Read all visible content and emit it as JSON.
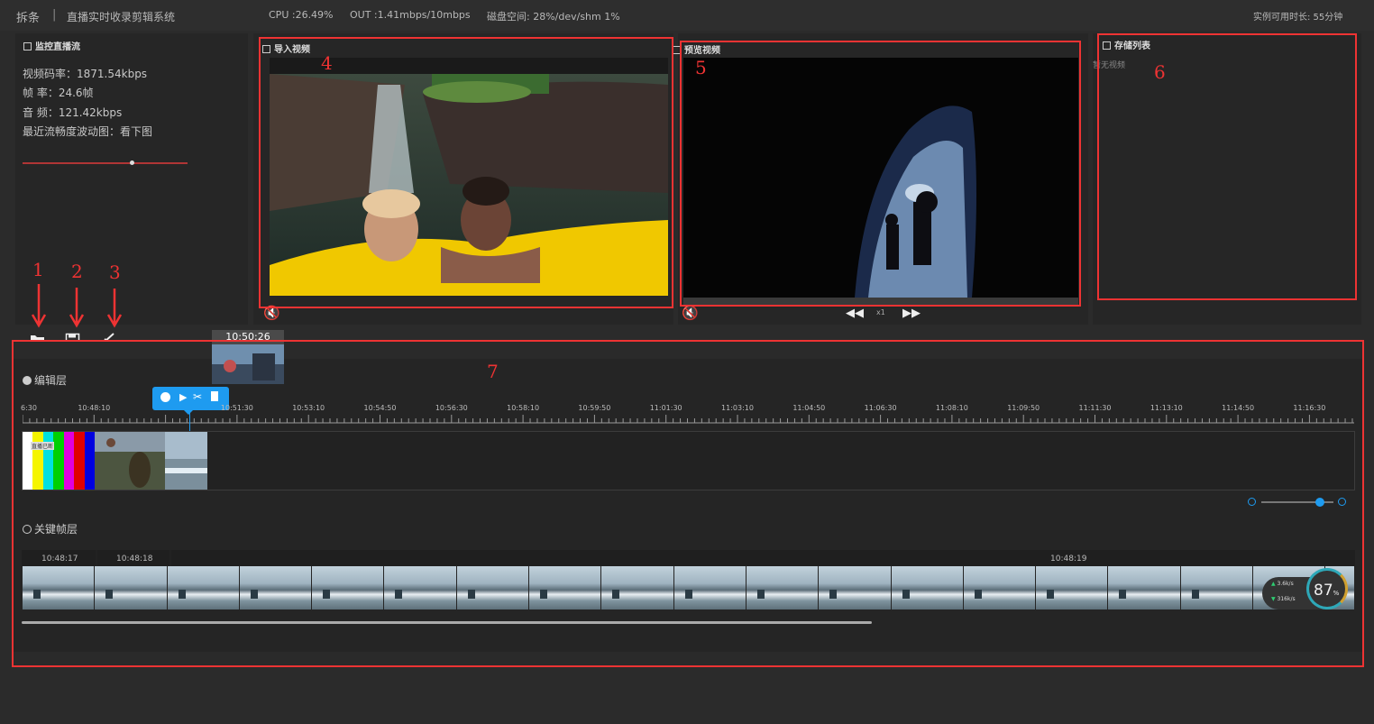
{
  "app": {
    "name": "拆条",
    "system": "直播实时收录剪辑系统",
    "cpu": "CPU :26.49%",
    "out": "OUT :1.41mbps/10mbps",
    "disk": "磁盘空间: 28%/dev/shm 1%",
    "remaining": "实例可用时长: 55分钟"
  },
  "monitor": {
    "title": "监控直播流",
    "bitrate": "视频码率：1871.54kbps",
    "fps": "帧    率：24.6帧",
    "audio": "音    频：121.42kbps",
    "fluency": "最近流畅度波动图：看下图"
  },
  "import_video": {
    "title": "导入视频"
  },
  "preview_video": {
    "title": "预览视频",
    "speed": "x1"
  },
  "storage": {
    "title": "存储列表",
    "empty": "暂无视频"
  },
  "annotations": [
    "1",
    "2",
    "3",
    "4",
    "5",
    "6",
    "7"
  ],
  "timeline": {
    "hover_time": "10:50:26",
    "edit_layer_label": "编辑层",
    "ticks": [
      "6:30",
      "10:48:10",
      "",
      "10:51:30",
      "10:53:10",
      "10:54:50",
      "10:56:30",
      "10:58:10",
      "10:59:50",
      "11:01:30",
      "11:03:10",
      "11:04:50",
      "11:06:30",
      "11:08:10",
      "11:09:50",
      "11:11:30",
      "11:13:10",
      "11:14:50",
      "11:16:30"
    ],
    "clip_label": "直播已断",
    "keyframe_layer_label": "关键帧层",
    "keyframe_times": [
      "10:48:17",
      "10:48:18",
      "10:48:19"
    ]
  },
  "meter": {
    "up": "3.6k/s",
    "down": "316k/s",
    "percent": "87",
    "unit": "%"
  },
  "colors": {
    "annotation": "#e33333",
    "accent": "#1e9bf0",
    "panel": "#262626"
  },
  "icons": [
    "folder-icon",
    "save-icon",
    "scissors-icon",
    "mute-icon",
    "rewind-icon",
    "fast-forward-icon",
    "play-icon",
    "delete-icon",
    "zoom-out-icon",
    "zoom-in-icon"
  ]
}
